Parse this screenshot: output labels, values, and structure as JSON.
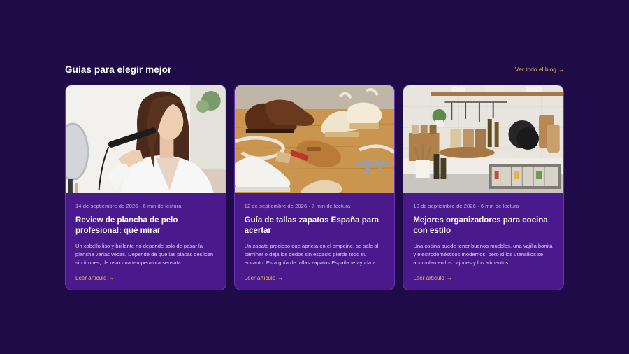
{
  "section": {
    "title": "Guías para elegir mejor",
    "view_all_label": "Ver todo el blog",
    "arrow": "→"
  },
  "cards": [
    {
      "meta": "14 de septiembre de 2026 · 6 min de lectura",
      "title": "Review de plancha de pelo profesional: qué mirar",
      "excerpt": "Un cabello liso y brillante no depende solo de pasar la plancha varias veces. Depende de que las placas deslicen sin tirones, de usar una temperatura sensata ...",
      "link_label": "Leer artículo",
      "image": "woman-using-hair-straightener"
    },
    {
      "meta": "12 de septiembre de 2026 · 7 min de lectura",
      "title": "Guía de tallas zapatos España para acertar",
      "excerpt": "Un zapato precioso que aprieta en el empeine, se sale al caminar o deja los dedos sin espacio pierde todo su encanto. Esta guía de tallas zapatos España te ayuda a...",
      "link_label": "Leer artículo",
      "image": "shoes-and-measuring-tools"
    },
    {
      "meta": "10 de septiembre de 2026 · 6 min de lectura",
      "title": "Mejores organizadores para cocina con estilo",
      "excerpt": "Una cocina puede tener buenos muebles, una vajilla bonita y electrodomésticos modernos, pero si los utensilios se acumulan en los cajones y los alimentos...",
      "link_label": "Leer artículo",
      "image": "kitchen-organizers"
    }
  ],
  "colors": {
    "background": "#1e0b47",
    "card": "#4a1a8c",
    "accent": "#f2c24e"
  }
}
